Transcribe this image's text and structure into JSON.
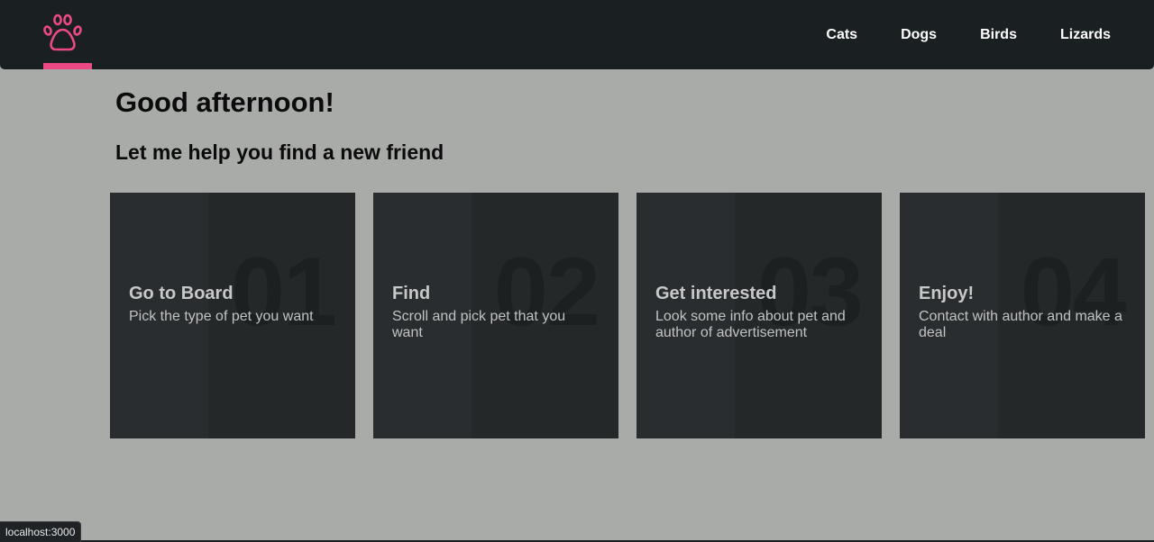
{
  "nav": {
    "logo_icon": "paw-icon",
    "accent_color": "#ec4a85",
    "links": [
      {
        "label": "Cats"
      },
      {
        "label": "Dogs"
      },
      {
        "label": "Birds"
      },
      {
        "label": "Lizards"
      }
    ]
  },
  "main": {
    "greeting": "Good afternoon!",
    "subtitle": "Let me help you find a new friend"
  },
  "steps": [
    {
      "number": "01",
      "title": "Go to Board",
      "description": "Pick the type of pet you want"
    },
    {
      "number": "02",
      "title": "Find",
      "description": "Scroll and pick pet that you want"
    },
    {
      "number": "03",
      "title": "Get interested",
      "description": "Look some info about pet and author of advertisement"
    },
    {
      "number": "04",
      "title": "Enjoy!",
      "description": "Contact with author and make a deal"
    }
  ],
  "status_bar": {
    "url": "localhost:3000"
  }
}
